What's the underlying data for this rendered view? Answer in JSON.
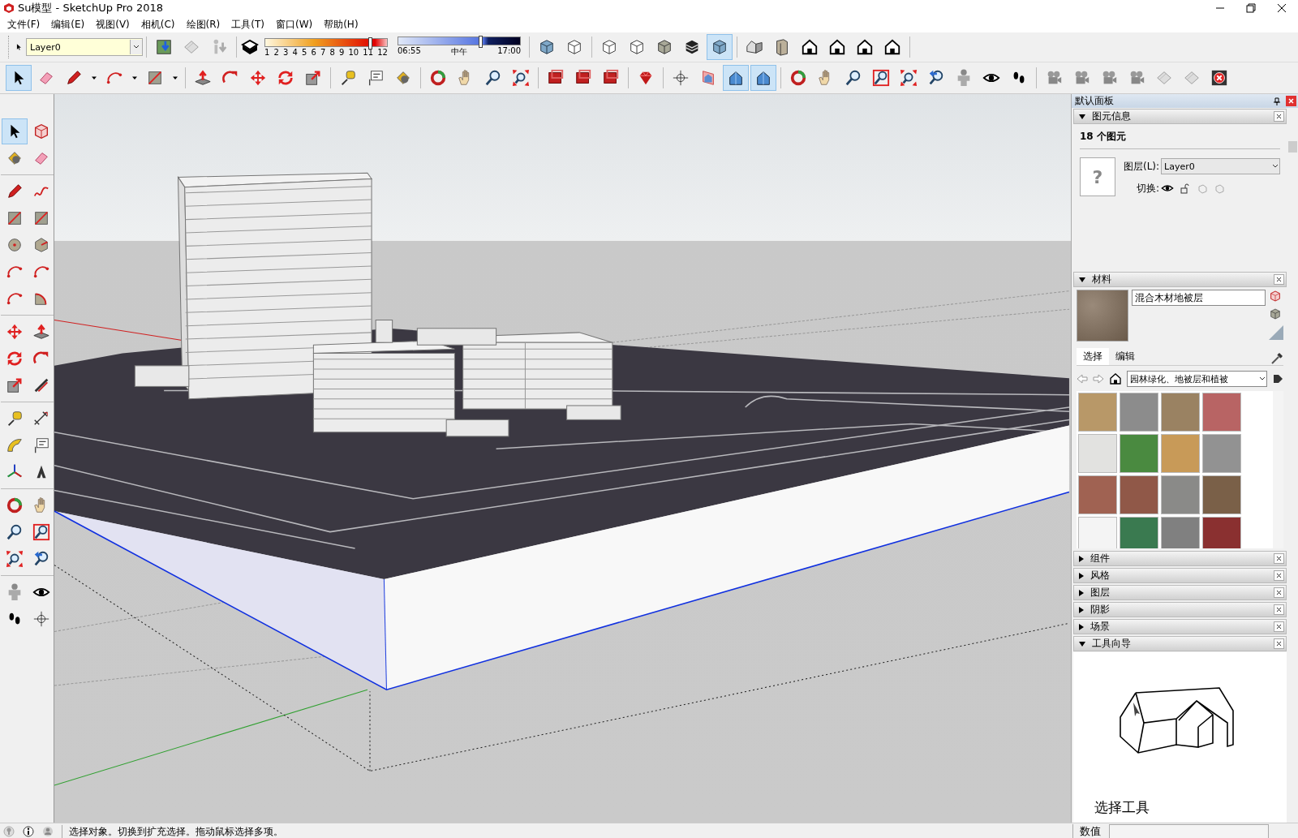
{
  "window": {
    "title": "Su模型 - SketchUp Pro 2018"
  },
  "menu": [
    "文件(F)",
    "编辑(E)",
    "视图(V)",
    "相机(C)",
    "绘图(R)",
    "工具(T)",
    "窗口(W)",
    "帮助(H)"
  ],
  "toolbar_1": {
    "layer": "Layer0",
    "buttons": [
      {
        "selected": false
      },
      {
        "selected": false
      },
      {
        "selected": false
      },
      {
        "selected": false
      },
      {
        "selected": false
      },
      {
        "selected": false
      },
      {
        "selected": false
      },
      {
        "selected": false
      },
      {
        "selected": false
      },
      {
        "selected": true
      },
      {
        "selected": false
      },
      {
        "selected": false
      },
      {
        "selected": false
      },
      {
        "selected": false
      },
      {
        "selected": false
      },
      {
        "selected": false
      }
    ],
    "shadow": {
      "months": [
        "1",
        "2",
        "3",
        "4",
        "5",
        "6",
        "7",
        "8",
        "9",
        "10",
        "11",
        "12"
      ],
      "date_slider": {
        "level": 0.86
      },
      "time_slider": {
        "level": 0.67
      },
      "times": [
        "06:55",
        "中午",
        "17:00"
      ]
    }
  },
  "toolbar_2_buttons": [
    {
      "selected": true
    },
    {
      "selected": false
    },
    {
      "selected": false
    },
    {
      "selected": false
    },
    {
      "selected": false
    },
    {
      "selected": false
    },
    {
      "selected": false
    },
    {
      "selected": false
    },
    {
      "selected": false
    },
    {
      "selected": false
    },
    {
      "selected": false
    },
    {
      "selected": false
    },
    {
      "selected": false
    },
    {
      "selected": false
    },
    {
      "selected": false
    },
    {
      "selected": false
    },
    {
      "selected": false
    },
    {
      "selected": false
    },
    {
      "selected": false
    },
    {
      "selected": false
    },
    {
      "selected": false
    },
    {
      "selected": false
    },
    {
      "selected": false
    },
    {
      "selected": false
    },
    {
      "selected": false
    },
    {
      "selected": false
    },
    {
      "selected": true
    },
    {
      "selected": true
    },
    {
      "selected": false
    },
    {
      "selected": false
    },
    {
      "selected": false
    },
    {
      "selected": false
    },
    {
      "selected": false
    },
    {
      "selected": false
    },
    {
      "selected": false
    },
    {
      "selected": false
    },
    {
      "selected": false
    },
    {
      "selected": false
    },
    {
      "selected": false
    },
    {
      "selected": false
    },
    {
      "selected": false
    },
    {
      "selected": false
    },
    {
      "selected": false
    },
    {
      "selected": false
    }
  ],
  "left_toolbar_buttons": [
    {
      "selected": true
    },
    {
      "selected": false
    },
    {
      "selected": false
    },
    {
      "selected": false
    },
    {
      "selected": false
    },
    {
      "selected": false
    },
    {
      "selected": false
    },
    {
      "selected": false
    },
    {
      "selected": false
    },
    {
      "selected": false
    },
    {
      "selected": false
    },
    {
      "selected": false
    },
    {
      "selected": false
    },
    {
      "selected": false
    },
    {
      "selected": false
    },
    {
      "selected": false
    },
    {
      "selected": false
    },
    {
      "selected": false
    },
    {
      "selected": false
    },
    {
      "selected": false
    },
    {
      "selected": false
    },
    {
      "selected": false
    },
    {
      "selected": false
    },
    {
      "selected": false
    },
    {
      "selected": false
    },
    {
      "selected": false
    },
    {
      "selected": false
    },
    {
      "selected": false
    },
    {
      "selected": false
    },
    {
      "selected": false
    },
    {
      "selected": false
    },
    {
      "selected": false
    },
    {
      "selected": false
    },
    {
      "selected": false
    },
    {
      "selected": false
    },
    {
      "selected": false
    }
  ],
  "tray": {
    "title": "默认面板",
    "entity_info": {
      "title": "图元信息",
      "expanded": true,
      "count": "18 个图元",
      "preview_mark": "?",
      "layer_label": "图层(L):",
      "layer": "Layer0",
      "toggle_label": "切换:"
    },
    "materials": {
      "title": "材料",
      "expanded": true,
      "name": "混合木材地被层",
      "tabs": [
        {
          "label": "选择",
          "selected": true
        },
        {
          "label": "编辑",
          "selected": false
        }
      ],
      "library": "园林绿化、地被层和植被",
      "swatches": [
        {
          "color": "#b89868"
        },
        {
          "color": "#8c8c8c"
        },
        {
          "color": "#9a8262"
        },
        {
          "color": "#b86464"
        },
        {
          "color": "#e2e2e0"
        },
        {
          "color": "#4a8a40"
        },
        {
          "color": "#c89a58"
        },
        {
          "color": "#929292"
        },
        {
          "color": "#a06252"
        },
        {
          "color": "#905848"
        },
        {
          "color": "#8a8a88"
        },
        {
          "color": "#7a6048"
        },
        {
          "color": "#f4f4f4"
        },
        {
          "color": "#3a7a50"
        },
        {
          "color": "#808080"
        },
        {
          "color": "#8a3030"
        }
      ]
    },
    "panels": [
      {
        "title": "组件",
        "expanded": false
      },
      {
        "title": "风格",
        "expanded": false
      },
      {
        "title": "图层",
        "expanded": false
      },
      {
        "title": "阴影",
        "expanded": false
      },
      {
        "title": "场景",
        "expanded": false
      },
      {
        "title": "工具向导",
        "expanded": true
      }
    ],
    "instructor": {
      "tool_name": "选择工具"
    }
  },
  "status_bar": {
    "text": "选择对象。切换到扩充选择。拖动鼠标选择多项。",
    "measurements_label": "数值"
  }
}
